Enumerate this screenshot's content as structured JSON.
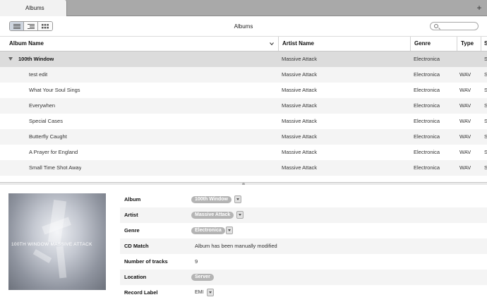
{
  "tab": {
    "label": "Albums",
    "add_icon": "plus-icon"
  },
  "toolbar": {
    "title": "Albums",
    "view_buttons": [
      "list-view-icon",
      "detail-view-icon",
      "grid-view-icon"
    ],
    "search_placeholder": ""
  },
  "table": {
    "columns": [
      "Album Name",
      "Artist Name",
      "Genre",
      "Type",
      "S"
    ],
    "group": {
      "name": "100th Window",
      "artist": "Massive Attack",
      "genre": "Electronica",
      "type": "",
      "extra": "S"
    },
    "rows": [
      {
        "name": "test edit",
        "artist": "Massive Attack",
        "genre": "Electronica",
        "type": "WAV",
        "extra": "S"
      },
      {
        "name": "What Your Soul Sings",
        "artist": "Massive Attack",
        "genre": "Electronica",
        "type": "WAV",
        "extra": "S"
      },
      {
        "name": "Everywhen",
        "artist": "Massive Attack",
        "genre": "Electronica",
        "type": "WAV",
        "extra": "S"
      },
      {
        "name": "Special Cases",
        "artist": "Massive Attack",
        "genre": "Electronica",
        "type": "WAV",
        "extra": "S"
      },
      {
        "name": "Butterfly Caught",
        "artist": "Massive Attack",
        "genre": "Electronica",
        "type": "WAV",
        "extra": "S"
      },
      {
        "name": "A Prayer for England",
        "artist": "Massive Attack",
        "genre": "Electronica",
        "type": "WAV",
        "extra": "S"
      },
      {
        "name": "Small Time Shot Away",
        "artist": "Massive Attack",
        "genre": "Electronica",
        "type": "WAV",
        "extra": "S"
      }
    ]
  },
  "details": {
    "cover_text": "100TH WINDOW MASSIVE ATTACK",
    "album": {
      "label": "Album",
      "value": "100th Window"
    },
    "artist": {
      "label": "Artist",
      "value": "Massive Attack"
    },
    "genre": {
      "label": "Genre",
      "value": "Electronica"
    },
    "cd_match": {
      "label": "CD Match",
      "value": "Album has been manually modified"
    },
    "tracks": {
      "label": "Number of tracks",
      "value": "9"
    },
    "location": {
      "label": "Location",
      "value": "Server"
    },
    "record_label": {
      "label": "Record Label",
      "value": "EMI"
    }
  }
}
